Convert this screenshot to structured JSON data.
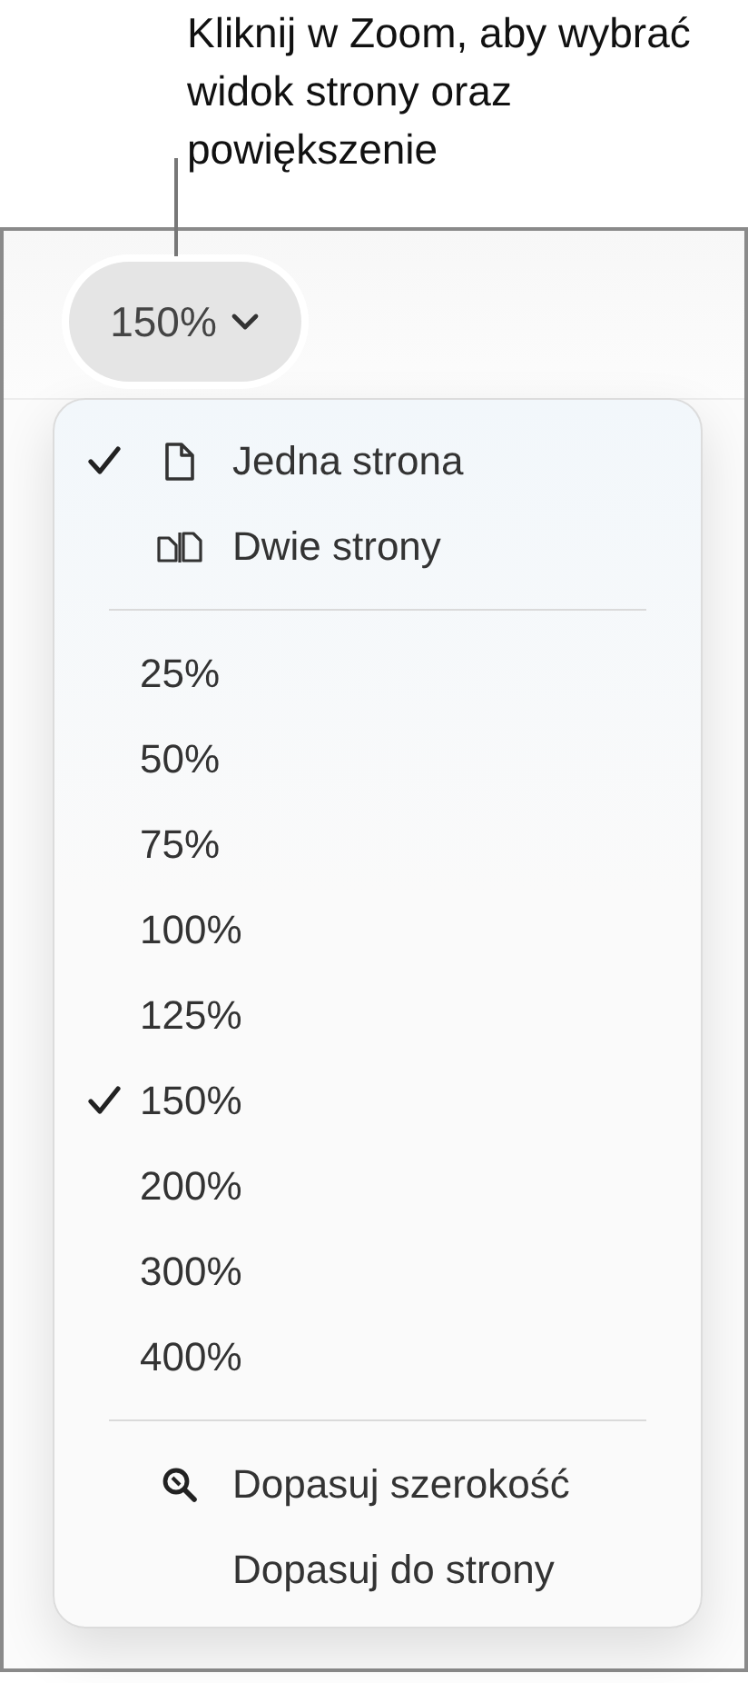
{
  "callout": "Kliknij w Zoom, aby wybrać widok strony oraz powiększenie",
  "zoom_button": {
    "label": "150%"
  },
  "menu": {
    "view_options": [
      {
        "label": "Jedna strona",
        "kind": "page",
        "selected": true
      },
      {
        "label": "Dwie strony",
        "kind": "two-pages",
        "selected": false
      }
    ],
    "zoom_levels": [
      {
        "label": "25%",
        "selected": false
      },
      {
        "label": "50%",
        "selected": false
      },
      {
        "label": "75%",
        "selected": false
      },
      {
        "label": "100%",
        "selected": false
      },
      {
        "label": "125%",
        "selected": false
      },
      {
        "label": "150%",
        "selected": true
      },
      {
        "label": "200%",
        "selected": false
      },
      {
        "label": "300%",
        "selected": false
      },
      {
        "label": "400%",
        "selected": false
      }
    ],
    "fit_options": [
      {
        "label": "Dopasuj szerokość",
        "kind": "magnifier"
      },
      {
        "label": "Dopasuj do strony",
        "kind": "plain"
      }
    ]
  }
}
